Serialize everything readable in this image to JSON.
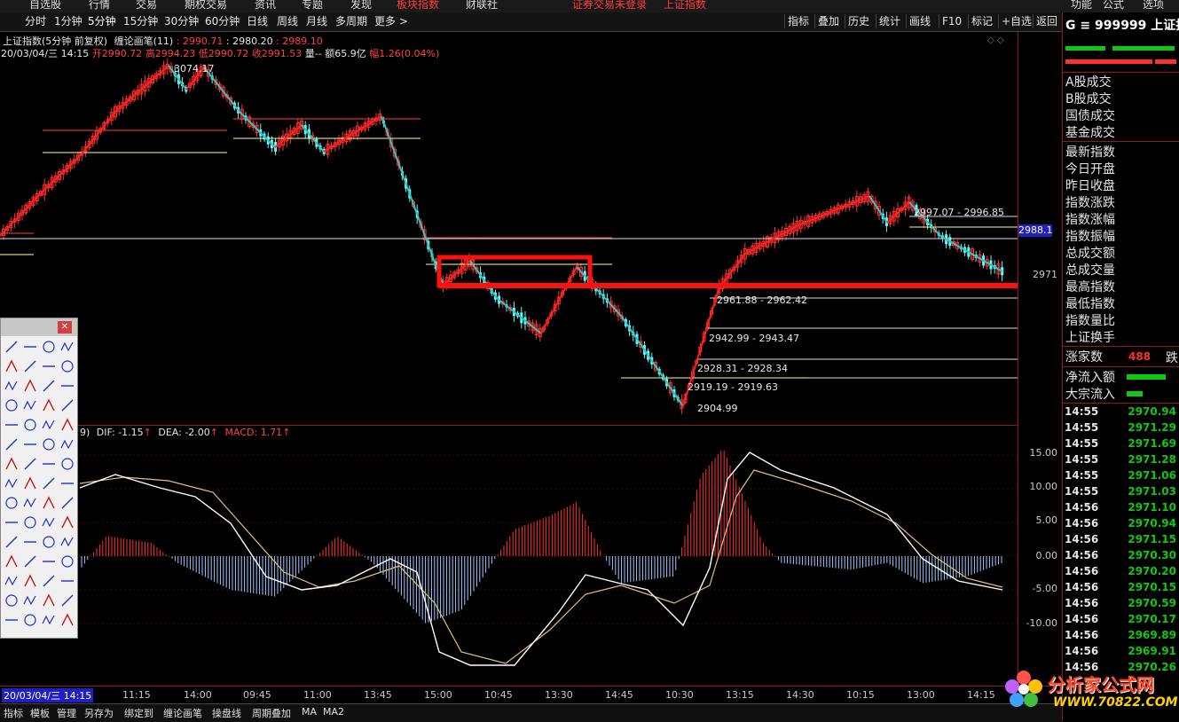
{
  "topmenu": [
    "自选股",
    "行情",
    "交易",
    "期权交易",
    "资讯",
    "专题",
    "发现",
    "板块指数",
    "财联社",
    "证券交易未登录",
    "上证指数",
    "功能",
    "公式",
    "选项"
  ],
  "periods": [
    "分时",
    "1分钟",
    "5分钟",
    "15分钟",
    "30分钟",
    "60分钟",
    "日线",
    "周线",
    "月线",
    "多周期",
    "更多 >"
  ],
  "tools_right": [
    "指标",
    "叠加",
    "历史",
    "统计",
    "画线",
    "F10",
    "标记",
    "+自选",
    "返回"
  ],
  "chart_title": "上证指数(5分钟 前复权)",
  "indicator_name": "缠论画笔(11)",
  "indicator_vals": [
    ": 2990.71",
    ": 2980.20",
    ": 2989.10"
  ],
  "bar_info_date": "20/03/04/三 14:15",
  "bar_info": [
    "开2990.72",
    "高2994.23",
    "低2990.72",
    "收2991.53",
    "量--",
    "额65.9亿",
    "幅1.26(0.04%)"
  ],
  "annotations": [
    "3074.17",
    "2997.07 - 2996.85",
    "2961.88 - 2962.42",
    "2942.99 - 2943.47",
    "2928.31 - 2928.34",
    "2919.19 - 2919.63",
    "2904.99"
  ],
  "price_right": [
    "2988.1",
    "2971"
  ],
  "macd_label": "9)",
  "macd_vals": [
    "DIF: -1.15",
    "DEA: -2.00",
    "MACD: 1.71"
  ],
  "macd_axis": [
    "15.00",
    "10.00",
    "5.00",
    "0.00",
    "-5.00",
    "-10.00"
  ],
  "x_axis": [
    "20/03/04/三 14:15",
    "11:15",
    "14:00",
    "09:45",
    "11:00",
    "13:45",
    "15:00",
    "10:45",
    "13:30",
    "14:45",
    "10:30",
    "13:15",
    "14:30",
    "10:15",
    "13:00",
    "14:15"
  ],
  "bottom_tabs": [
    "指标",
    "模板",
    "管理",
    "另存为",
    "绑定到",
    "缠论画笔",
    "操盘线",
    "周期叠加",
    "MA",
    "MA2"
  ],
  "quote": {
    "header": "G ≡ 999999 上证指",
    "rows": [
      "A股成交",
      "B股成交",
      "国债成交",
      "基金成交",
      "最新指数",
      "今日开盘",
      "昨日收盘",
      "指数涨跌",
      "指数涨幅",
      "指数振幅",
      "总成交额",
      "总成交量",
      "最高指数",
      "最低指数",
      "指数量比",
      "上证换手"
    ],
    "up_label": "涨家数",
    "up_value": "488",
    "down_label": "跌",
    "flow": [
      "净流入额",
      "大宗流入"
    ],
    "ticks": [
      [
        "14:55",
        "2970.94"
      ],
      [
        "14:55",
        "2971.29"
      ],
      [
        "14:55",
        "2971.69"
      ],
      [
        "14:55",
        "2971.28"
      ],
      [
        "14:55",
        "2971.06"
      ],
      [
        "14:55",
        "2971.03"
      ],
      [
        "14:56",
        "2971.10"
      ],
      [
        "14:56",
        "2970.94"
      ],
      [
        "14:56",
        "2971.15"
      ],
      [
        "14:56",
        "2970.30"
      ],
      [
        "14:56",
        "2970.20"
      ],
      [
        "14:56",
        "2970.15"
      ],
      [
        "14:56",
        "2970.59"
      ],
      [
        "14:56",
        "2970.17"
      ],
      [
        "14:56",
        "2969.89"
      ],
      [
        "14:56",
        "2969.91"
      ],
      [
        "14:56",
        "2970.26"
      ]
    ]
  },
  "watermark": {
    "title": "分析家公式网",
    "url": "WWW.70822.COM"
  },
  "colors": {
    "up": "#ff3030",
    "down": "#54ffff",
    "bi": "#ff2020",
    "seg": "#3fc0c0",
    "pivot": "#ffff90",
    "macd_pos": "#ff3030",
    "macd_neg": "#a0c8ff",
    "dif": "#ffffff",
    "dea": "#e0c080",
    "green": "#11c811"
  }
}
